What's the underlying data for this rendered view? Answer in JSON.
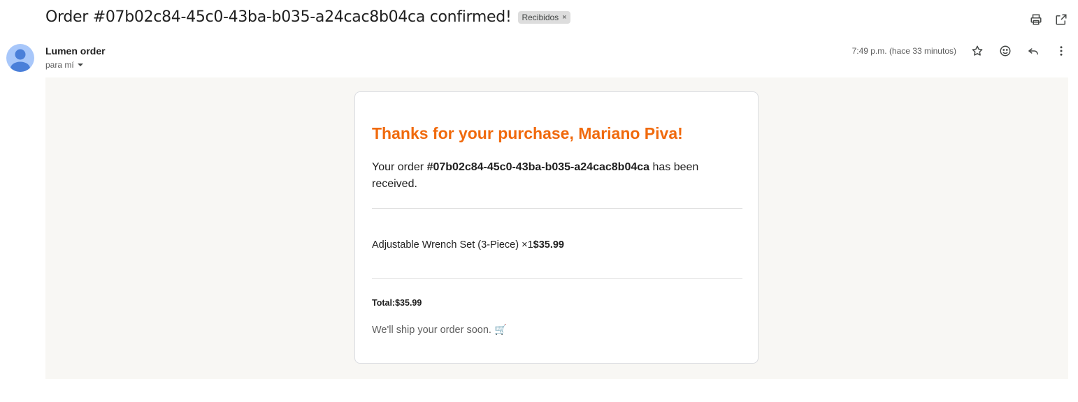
{
  "header": {
    "subject": "Order #07b02c84-45c0-43ba-b035-a24cac8b04ca confirmed!",
    "label": "Recibidos",
    "label_close": "×"
  },
  "sender": {
    "name": "Lumen order",
    "to": "para mí",
    "time": "7:49 p.m. (hace 33 minutos)"
  },
  "email": {
    "heading": "Thanks for your purchase, Mariano Piva!",
    "order_prefix": "Your order ",
    "order_id": "#07b02c84-45c0-43ba-b035-a24cac8b04ca",
    "order_suffix": " has been received.",
    "item_desc": "Adjustable Wrench Set (3-Piece) ×1",
    "item_price": "$35.99",
    "total_label": "Total:",
    "total_value": "$35.99",
    "ship_msg": "We'll ship your order soon. 🛒"
  },
  "icons": {
    "top": [
      "print-icon",
      "open-in-new-window-icon"
    ],
    "message": [
      "star-icon",
      "emoji-icon",
      "reply-icon",
      "more-vert-icon"
    ]
  },
  "colors": {
    "heading_accent": "#f06a0d",
    "body_bg": "#f8f7f4",
    "avatar_bg": "#a8c7fa",
    "avatar_fg": "#4a7fd9"
  }
}
